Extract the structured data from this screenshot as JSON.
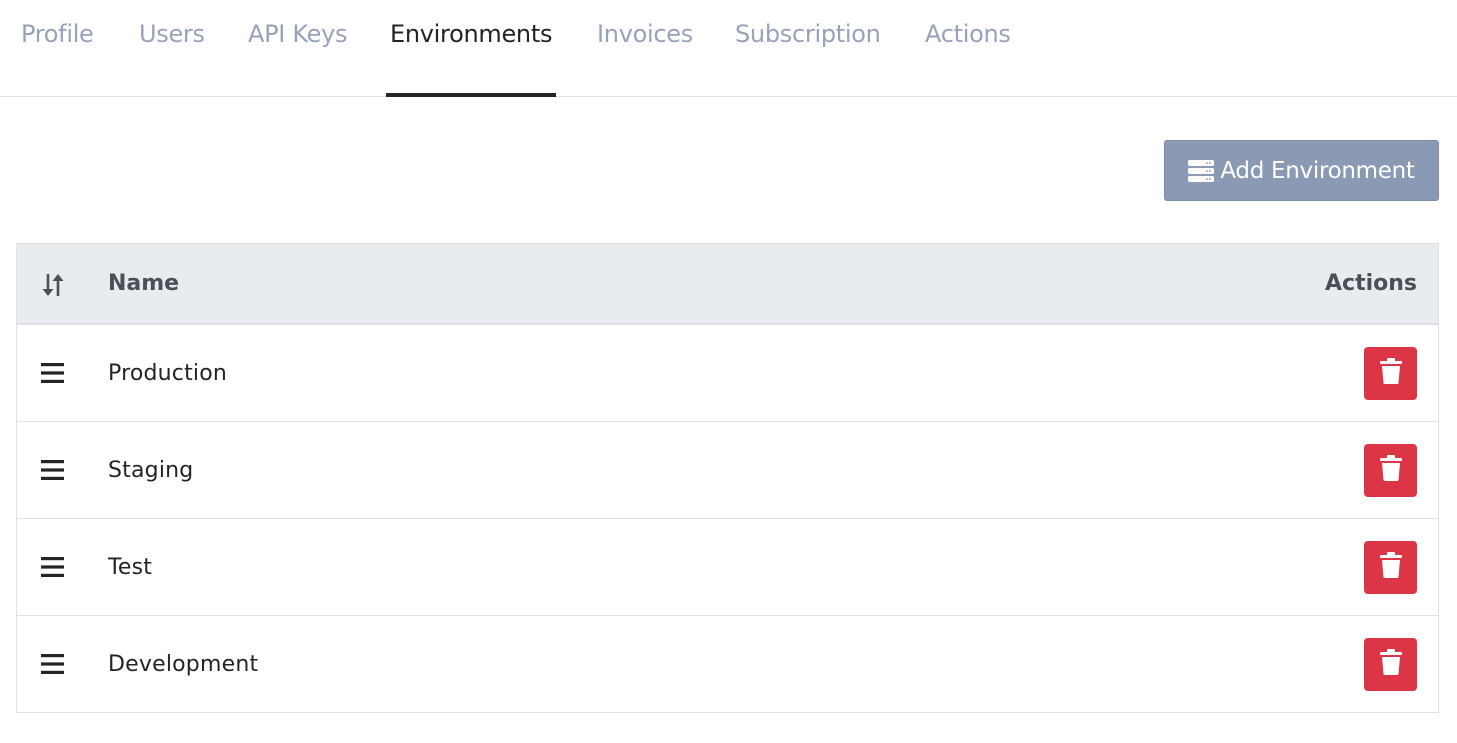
{
  "tabs": [
    {
      "label": "Profile",
      "active": false
    },
    {
      "label": "Users",
      "active": false
    },
    {
      "label": "API Keys",
      "active": false
    },
    {
      "label": "Environments",
      "active": true
    },
    {
      "label": "Invoices",
      "active": false
    },
    {
      "label": "Subscription",
      "active": false
    },
    {
      "label": "Actions",
      "active": false
    }
  ],
  "toolbar": {
    "add_label": "Add Environment",
    "add_icon": "server-icon"
  },
  "table": {
    "sort_icon": "sort-arrows-icon",
    "headers": {
      "name": "Name",
      "actions": "Actions"
    },
    "rows": [
      {
        "name": "Production"
      },
      {
        "name": "Staging"
      },
      {
        "name": "Test"
      },
      {
        "name": "Development"
      }
    ],
    "row_drag_icon": "drag-handle-icon",
    "row_delete_icon": "trash-icon"
  },
  "colors": {
    "tab_inactive": "#98a2bb",
    "tab_active": "#212529",
    "add_button_bg": "#8a9ab5",
    "delete_button_bg": "#dc3545",
    "table_header_bg": "#e9ecef"
  }
}
